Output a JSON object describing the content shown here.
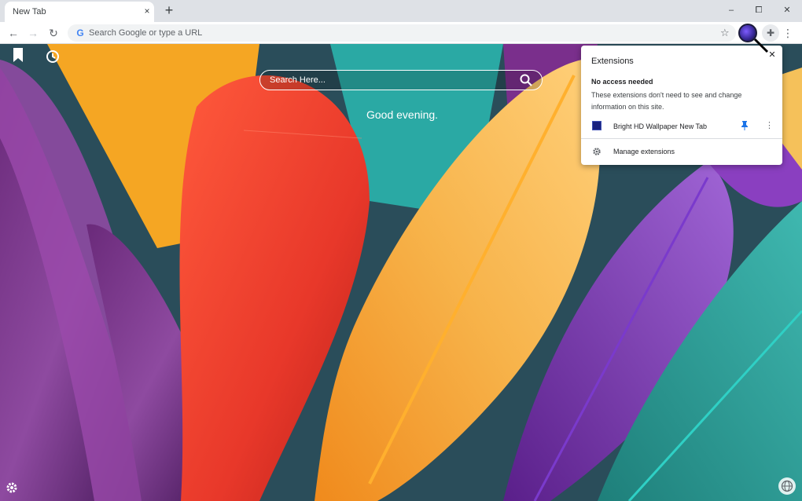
{
  "tab": {
    "title": "New Tab",
    "close": "×",
    "new_tab": "+"
  },
  "window_controls": {
    "minimize": "–",
    "maximize": "⧠",
    "close": "✕"
  },
  "toolbar": {
    "back": "←",
    "forward": "→",
    "reload": "↻",
    "omnibox_placeholder": "Search Google or type a URL",
    "star": "☆",
    "puzzle": "✚",
    "menu": "⋮"
  },
  "page": {
    "search_placeholder": "Search Here...",
    "greeting": "Good evening.",
    "bookmark_icon": "bookmark-icon",
    "history_icon": "history-icon",
    "settings_icon": "gear-icon",
    "globe_icon": "globe-icon"
  },
  "extensions_popup": {
    "title": "Extensions",
    "close": "✕",
    "heading": "No access needed",
    "description": "These extensions don't need to see and change information on this site.",
    "extension_name": "Bright HD Wallpaper New Tab",
    "manage_label": "Manage extensions"
  },
  "colors": {
    "chrome_frame": "#dee1e6",
    "toolbar": "#ffffff",
    "accent_blue": "#1a73e8"
  }
}
